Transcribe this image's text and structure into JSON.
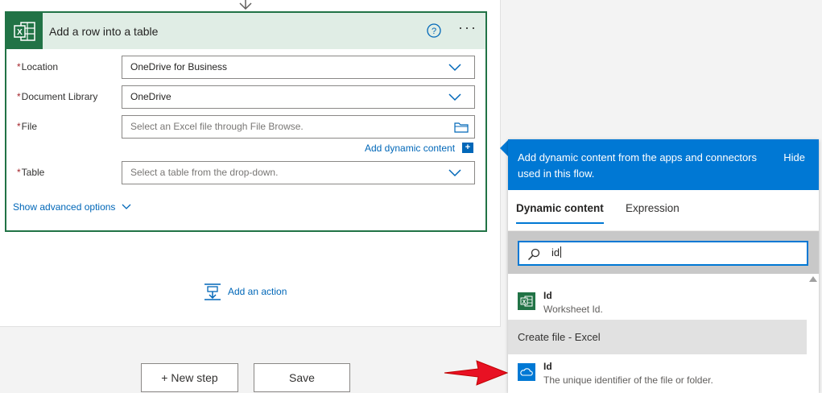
{
  "card": {
    "title": "Add a row into a table",
    "icon": "excel-icon",
    "fields": [
      {
        "label": "Location",
        "value": "OneDrive for Business",
        "required": true
      },
      {
        "label": "Document Library",
        "value": "OneDrive",
        "required": true
      },
      {
        "label": "File",
        "placeholder": "Select an Excel file through File Browse.",
        "required": true
      },
      {
        "label": "Table",
        "placeholder": "Select a table from the drop-down.",
        "required": true
      }
    ],
    "required_marker": "*",
    "add_dynamic_content": "Add dynamic content",
    "add_dynamic_plus": "+",
    "show_advanced": "Show advanced options",
    "more": "···",
    "accent": "#217346"
  },
  "canvas": {
    "add_action": "Add an action",
    "new_step": "+ New step",
    "save": "Save"
  },
  "panel": {
    "header": "Add dynamic content from the apps and connectors used in this flow.",
    "hide": "Hide",
    "tabs": [
      "Dynamic content",
      "Expression"
    ],
    "search_value": "id",
    "results": [
      {
        "name": "Id",
        "desc": "Worksheet Id.",
        "icon": "excel-icon"
      },
      {
        "name": "Id",
        "desc": "The unique identifier of the file or folder.",
        "icon": "onedrive-icon"
      }
    ],
    "group": "Create file - Excel",
    "accent": "#0078d4"
  }
}
